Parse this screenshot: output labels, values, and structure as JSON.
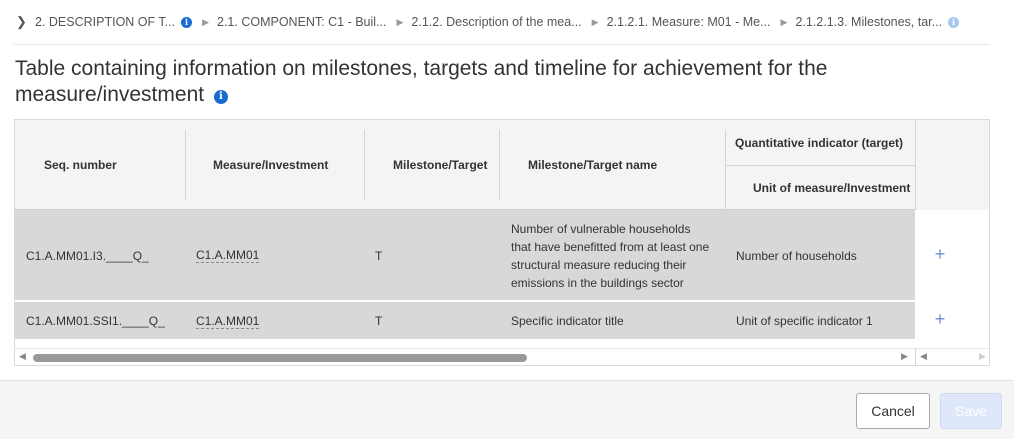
{
  "breadcrumb": {
    "items": [
      "2. DESCRIPTION OF T...",
      "2.1. COMPONENT: C1 - Buil...",
      "2.1.2. Description of the mea...",
      "2.1.2.1. Measure: M01 - Me...",
      "2.1.2.1.3. Milestones, tar..."
    ]
  },
  "page": {
    "title": "Table containing information on milestones, targets and timeline for achievement for the measure/investment"
  },
  "table": {
    "headers": {
      "seq": "Seq. number",
      "measure": "Measure/Investment",
      "type": "Milestone/Target",
      "name": "Milestone/Target name",
      "group": "Quantitative indicator (target)",
      "unit": "Unit of measure/Investment"
    },
    "rows": [
      {
        "seq": "C1.A.MM01.I3.____Q_",
        "measure": "C1.A.MM01",
        "type": "T",
        "name": "Number of vulnerable households that have benefitted from at least one structural measure reducing their emissions in the buildings sector",
        "unit": "Number of households"
      },
      {
        "seq": "C1.A.MM01.SSI1.____Q_",
        "measure": "C1.A.MM01",
        "type": "T",
        "name": "Specific indicator title",
        "unit": "Unit of specific indicator 1"
      }
    ],
    "add_icon": "plus-icon"
  },
  "footer": {
    "cancel_label": "Cancel",
    "save_label": "Save"
  },
  "colors": {
    "accent": "#1a6bd0",
    "row_bg": "#d8d8d8",
    "header_bg": "#f4f4f4"
  }
}
